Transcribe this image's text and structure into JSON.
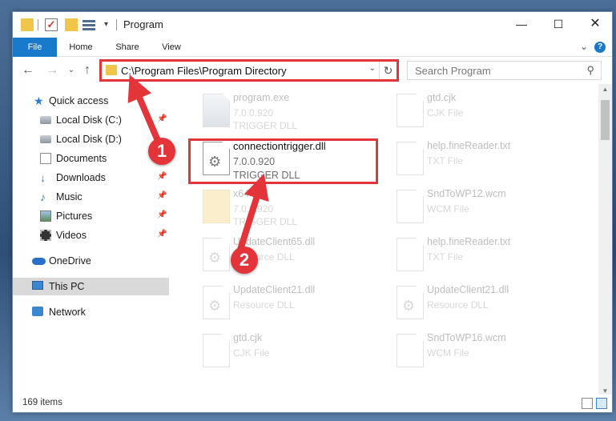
{
  "window": {
    "title": "Program",
    "controls": {
      "minimize": "—",
      "maximize": "☐",
      "close": "✕"
    }
  },
  "quick_access_toolbar": {
    "dropdown": "▾"
  },
  "ribbon": {
    "tabs": [
      {
        "label": "File"
      },
      {
        "label": "Home"
      },
      {
        "label": "Share"
      },
      {
        "label": "View"
      }
    ],
    "expand": "⌄",
    "help": "?"
  },
  "nav": {
    "back": "←",
    "forward": "→",
    "recent": "⌄",
    "up": "↑",
    "address": "C:\\Program Files\\Program Directory",
    "address_dropdown": "⌄",
    "refresh": "↻",
    "search_placeholder": "Search Program",
    "search_icon": "⚲"
  },
  "sidebar": {
    "items": [
      {
        "label": "Quick access",
        "icon": "star-icon",
        "glyph": "★",
        "pinned": false
      },
      {
        "label": "Local Disk (C:)",
        "icon": "disk-icon",
        "glyph": "",
        "pinned": true
      },
      {
        "label": "Local Disk (D:)",
        "icon": "disk-icon",
        "glyph": "",
        "pinned": false
      },
      {
        "label": "Documents",
        "icon": "documents-icon",
        "glyph": "",
        "pinned": false
      },
      {
        "label": "Downloads",
        "icon": "download-icon",
        "glyph": "↓",
        "pinned": true
      },
      {
        "label": "Music",
        "icon": "music-icon",
        "glyph": "♪",
        "pinned": true
      },
      {
        "label": "Pictures",
        "icon": "pictures-icon",
        "glyph": "",
        "pinned": true
      },
      {
        "label": "Videos",
        "icon": "videos-icon",
        "glyph": "",
        "pinned": true
      },
      {
        "label": "OneDrive",
        "icon": "cloud-icon",
        "glyph": "",
        "pinned": false
      },
      {
        "label": "This PC",
        "icon": "computer-icon",
        "glyph": "",
        "pinned": false,
        "selected": true
      },
      {
        "label": "Network",
        "icon": "network-icon",
        "glyph": "",
        "pinned": false
      }
    ],
    "pin_glyph": "📌"
  },
  "files": [
    {
      "name": "program.exe",
      "version": "7.0.0.920",
      "type": "TRIGGER DLL",
      "icon": "exe-icon",
      "faded": true
    },
    {
      "name": "gtd.cjk",
      "version": "",
      "type": "CJK File",
      "icon": "file-icon",
      "faded": true
    },
    {
      "name": "connectiontrigger.dll",
      "version": "7.0.0.920",
      "type": "TRIGGER DLL",
      "icon": "dll-gear-icon",
      "faded": false
    },
    {
      "name": "help.fineReader.txt",
      "version": "",
      "type": "TXT File",
      "icon": "file-icon",
      "faded": true
    },
    {
      "name": "x64",
      "version": "7.0.0.920",
      "type": "TRIGGER DLL",
      "icon": "folder-icon",
      "faded": true
    },
    {
      "name": "SndToWP12.wcm",
      "version": "",
      "type": "WCM File",
      "icon": "file-icon",
      "faded": true
    },
    {
      "name": "UpdateClient65.dll",
      "version": "",
      "type": "Resource DLL",
      "icon": "dll-gear-icon",
      "faded": true
    },
    {
      "name": "help.fineReader.txt",
      "version": "",
      "type": "TXT File",
      "icon": "file-icon",
      "faded": true
    },
    {
      "name": "UpdateClient21.dll",
      "version": "",
      "type": "Resource DLL",
      "icon": "dll-gear-icon",
      "faded": true
    },
    {
      "name": "UpdateClient21.dll",
      "version": "",
      "type": "Resource DLL",
      "icon": "dll-gear-icon",
      "faded": true
    },
    {
      "name": "gtd.cjk",
      "version": "",
      "type": "CJK File",
      "icon": "file-icon",
      "faded": true
    },
    {
      "name": "SndToWP16.wcm",
      "version": "",
      "type": "WCM File",
      "icon": "file-icon",
      "faded": true
    }
  ],
  "status": {
    "item_count": "169 items"
  },
  "scrollbar": {
    "up": "▲",
    "down": "▼"
  },
  "annotations": {
    "step1": "1",
    "step2": "2",
    "highlight_color": "#e3343a"
  }
}
